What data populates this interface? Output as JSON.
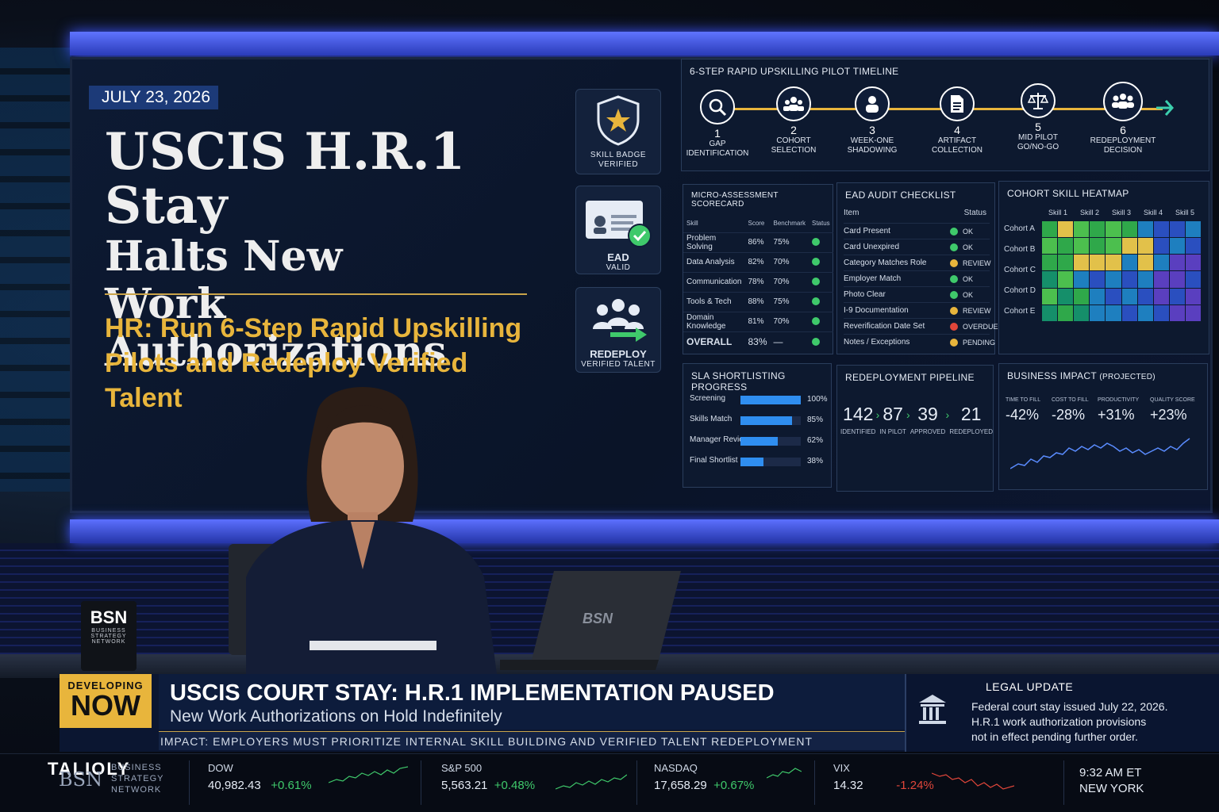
{
  "date": "JULY 23, 2026",
  "headline": {
    "line1": "USCIS H.R.1 Stay",
    "line2": "Halts New",
    "line3": "Work Authorizations"
  },
  "subhead": {
    "line1": "HR: Run 6-Step Rapid Upskilling",
    "line2": "Pilots and Redeploy Verified Talent"
  },
  "badges": {
    "skill": {
      "line1": "SKILL BADGE",
      "line2": "VERIFIED"
    },
    "ead": {
      "line1": "EAD",
      "line2": "VALID"
    },
    "redeploy": {
      "line1": "REDEPLOY",
      "line2": "VERIFIED TALENT"
    }
  },
  "timeline": {
    "title": "6-STEP RAPID UPSKILLING PILOT TIMELINE",
    "steps": [
      {
        "num": "1",
        "line1": "GAP",
        "line2": "IDENTIFICATION",
        "icon": "magnifier-icon"
      },
      {
        "num": "2",
        "line1": "COHORT",
        "line2": "SELECTION",
        "icon": "group-icon"
      },
      {
        "num": "3",
        "line1": "WEEK-ONE",
        "line2": "SHADOWING",
        "icon": "person-icon"
      },
      {
        "num": "4",
        "line1": "ARTIFACT",
        "line2": "COLLECTION",
        "icon": "document-icon"
      },
      {
        "num": "5",
        "line1": "MID PILOT",
        "line2": "GO/NO-GO",
        "icon": "scales-icon"
      },
      {
        "num": "6",
        "line1": "REDEPLOYMENT",
        "line2": "DECISION",
        "icon": "team-icon"
      }
    ]
  },
  "scorecard": {
    "title": "MICRO-ASSESSMENT SCORECARD",
    "headers": [
      "Skill",
      "Score",
      "Benchmark",
      "Status"
    ],
    "rows": [
      [
        "Problem Solving",
        "86%",
        "75%"
      ],
      [
        "Data Analysis",
        "82%",
        "70%"
      ],
      [
        "Communication",
        "78%",
        "70%"
      ],
      [
        "Tools & Tech",
        "88%",
        "75%"
      ],
      [
        "Domain Knowledge",
        "81%",
        "70%"
      ]
    ],
    "overall": {
      "label": "OVERALL",
      "score": "83%",
      "benchmark": "—"
    }
  },
  "ead_audit": {
    "title": "EAD AUDIT CHECKLIST",
    "headers": [
      "Item",
      "Status"
    ],
    "rows": [
      {
        "item": "Card Present",
        "status": "OK",
        "color": "#3fc96b"
      },
      {
        "item": "Card Unexpired",
        "status": "OK",
        "color": "#3fc96b"
      },
      {
        "item": "Category Matches Role",
        "status": "REVIEW",
        "color": "#e8b53c"
      },
      {
        "item": "Employer Match",
        "status": "OK",
        "color": "#3fc96b"
      },
      {
        "item": "Photo Clear",
        "status": "OK",
        "color": "#3fc96b"
      },
      {
        "item": "I-9 Documentation",
        "status": "REVIEW",
        "color": "#e8b53c"
      },
      {
        "item": "Reverification Date Set",
        "status": "OVERDUE",
        "color": "#e0463a"
      },
      {
        "item": "Notes / Exceptions",
        "status": "PENDING",
        "color": "#e8b53c"
      }
    ]
  },
  "heatmap": {
    "title": "COHORT SKILL HEATMAP",
    "columns": [
      "Skill 1",
      "Skill 2",
      "Skill 3",
      "Skill 4",
      "Skill 5"
    ],
    "rows": [
      "Cohort A",
      "Cohort B",
      "Cohort C",
      "Cohort D",
      "Cohort E"
    ]
  },
  "sla": {
    "title": "SLA SHORTLISTING PROGRESS",
    "rows": [
      {
        "label": "Screening",
        "pct": "100%",
        "fill": 1.0
      },
      {
        "label": "Skills Match",
        "pct": "85%",
        "fill": 0.85
      },
      {
        "label": "Manager Review",
        "pct": "62%",
        "fill": 0.62
      },
      {
        "label": "Final Shortlist",
        "pct": "38%",
        "fill": 0.38
      }
    ]
  },
  "pipeline": {
    "title": "REDEPLOYMENT PIPELINE",
    "stages": [
      {
        "value": "142",
        "label": "IDENTIFIED"
      },
      {
        "value": "87",
        "label": "IN PILOT"
      },
      {
        "value": "39",
        "label": "APPROVED"
      },
      {
        "value": "21",
        "label": "REDEPLOYED"
      }
    ]
  },
  "impact": {
    "title": "BUSINESS IMPACT",
    "title_note": "(PROJECTED)",
    "metrics": [
      {
        "label": "TIME TO FILL",
        "value": "-42%"
      },
      {
        "label": "COST TO FILL",
        "value": "-28%"
      },
      {
        "label": "PRODUCTIVITY",
        "value": "+31%"
      },
      {
        "label": "QUALITY SCORE",
        "value": "+23%"
      }
    ]
  },
  "mug": {
    "brand": "BSN",
    "line1": "BUSINESS",
    "line2": "STRATEGY",
    "line3": "NETWORK"
  },
  "laptop_brand": "BSN",
  "lower_third": {
    "tag_line1": "DEVELOPING",
    "tag_line2": "NOW",
    "headline": "USCIS COURT STAY: H.R.1 IMPLEMENTATION PAUSED",
    "subline": "New Work Authorizations on Hold Indefinitely",
    "impact": "IMPACT:  EMPLOYERS MUST PRIORITIZE INTERNAL SKILL BUILDING AND VERIFIED TALENT  REDEPLOYMENT",
    "legal_title": "LEGAL UPDATE",
    "legal_line1": "Federal court stay issued July 22, 2026.",
    "legal_line2": "H.R.1 work authorization provisions",
    "legal_line3": "not in effect pending further order."
  },
  "network": {
    "watermark": "TALIOLY",
    "brand": "BSN",
    "line1": "BUSINESS",
    "line2": "STRATEGY",
    "line3": "NETWORK"
  },
  "markets": [
    {
      "name": "DOW",
      "value": "40,982.43",
      "change": "+0.61%",
      "dir": "up"
    },
    {
      "name": "S&P 500",
      "value": "5,563.21",
      "change": "+0.48%",
      "dir": "up"
    },
    {
      "name": "NASDAQ",
      "value": "17,658.29",
      "change": "+0.67%",
      "dir": "up"
    },
    {
      "name": "VIX",
      "value": "14.32",
      "change": "-1.24%",
      "dir": "down"
    }
  ],
  "clock": {
    "time": "9:32 AM ET",
    "city": "NEW YORK"
  }
}
